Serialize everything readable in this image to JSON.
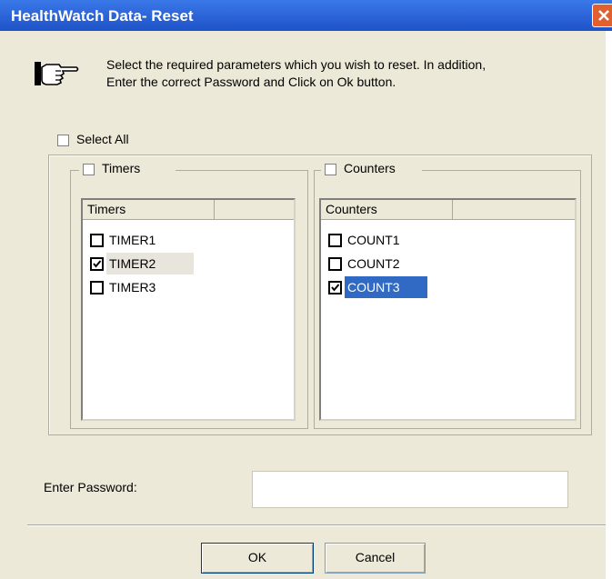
{
  "window": {
    "title": "HealthWatch Data- Reset"
  },
  "instruction": {
    "line1": "Select the required parameters which you wish to reset. In addition,",
    "line2": "Enter the correct Password and Click on Ok button."
  },
  "select_all": {
    "label": "Select All",
    "checked": false
  },
  "timers": {
    "group_label": "Timers",
    "group_checked": false,
    "column_header": "Timers",
    "items": [
      {
        "label": "TIMER1",
        "checked": false
      },
      {
        "label": "TIMER2",
        "checked": true
      },
      {
        "label": "TIMER3",
        "checked": false
      }
    ]
  },
  "counters": {
    "group_label": "Counters",
    "group_checked": false,
    "column_header": "Counters",
    "items": [
      {
        "label": "COUNT1",
        "checked": false
      },
      {
        "label": "COUNT2",
        "checked": false
      },
      {
        "label": "COUNT3",
        "checked": true,
        "selected": true
      }
    ]
  },
  "password": {
    "label": "Enter Password:",
    "value": ""
  },
  "buttons": {
    "ok": "OK",
    "cancel": "Cancel"
  },
  "colors": {
    "titlebar": "#1f52c8",
    "selection": "#316ac5",
    "dialog_bg": "#ece9d8"
  }
}
